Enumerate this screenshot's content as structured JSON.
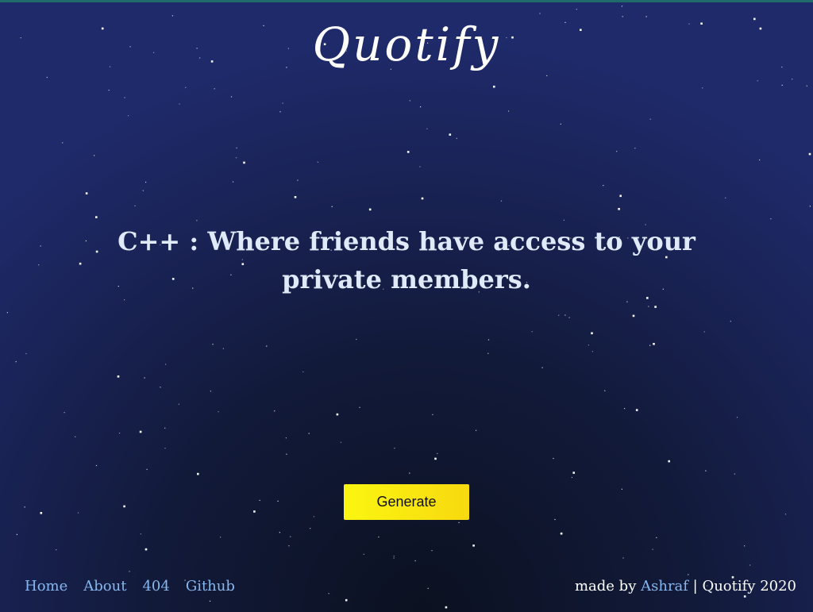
{
  "header": {
    "logo": "Quotify"
  },
  "main": {
    "quote": "C++ : Where friends have access to your private members.",
    "generate_label": "Generate"
  },
  "footer": {
    "nav": [
      "Home",
      "About",
      "404",
      "Github"
    ],
    "credit_prefix": "made by",
    "author": "Ashraf",
    "credit_suffix": "| Quotify 2020"
  },
  "colors": {
    "accent_button": "#f9e80f",
    "link": "#86b7f0",
    "background": "#1a2458"
  }
}
